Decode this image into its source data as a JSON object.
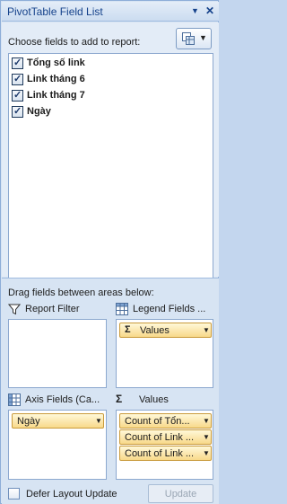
{
  "title": "PivotTable Field List",
  "choose_label": "Choose fields to add to report:",
  "fields": [
    {
      "label": "Tổng số link",
      "checked": true
    },
    {
      "label": "Link tháng 6",
      "checked": true
    },
    {
      "label": "Link tháng 7",
      "checked": true
    },
    {
      "label": "Ngày",
      "checked": true
    }
  ],
  "drag_label": "Drag fields between areas below:",
  "areas": {
    "report_filter": {
      "label": "Report Filter"
    },
    "legend_fields": {
      "label": "Legend Fields ...",
      "chips": [
        "Values"
      ]
    },
    "axis_fields": {
      "label": "Axis Fields (Ca...",
      "chips": [
        "Ngày"
      ]
    },
    "values": {
      "label": "Values",
      "chips": [
        "Count of Tổn...",
        "Count of Link ...",
        "Count of Link ..."
      ]
    }
  },
  "defer_label": "Defer Layout Update",
  "update_label": "Update",
  "icons": {
    "check": "✓",
    "dropdown": "▼",
    "close": "✕",
    "sigma": "Σ"
  }
}
